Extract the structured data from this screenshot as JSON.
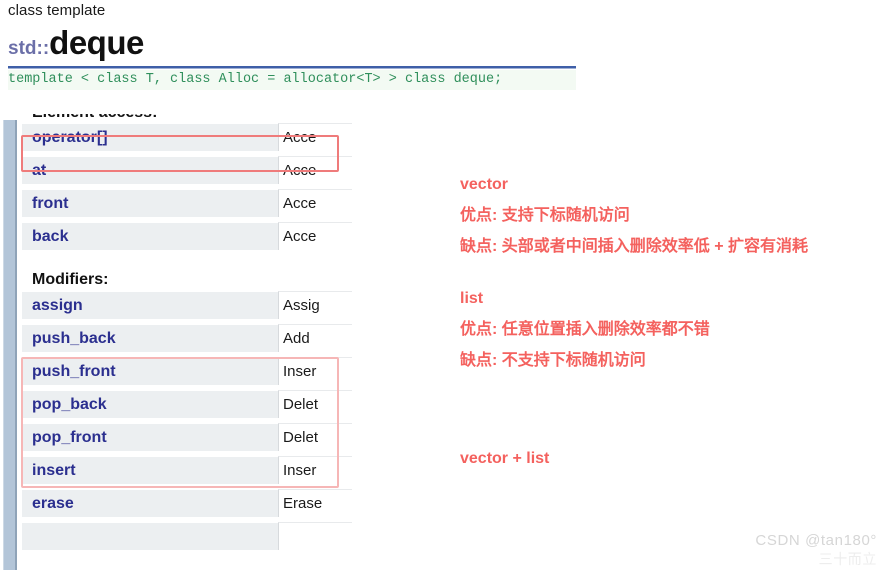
{
  "reference": {
    "kicker": "class template",
    "namespace": "std::",
    "class_name": "deque",
    "prototype": "template < class T, class Alloc = allocator<T> > class deque;"
  },
  "member_table": {
    "sections": [
      {
        "heading": "Element access:",
        "rows": [
          {
            "name": "operator[]",
            "desc": "Acce"
          },
          {
            "name": "at",
            "desc": "Acce"
          },
          {
            "name": "front",
            "desc": "Acce"
          },
          {
            "name": "back",
            "desc": "Acce"
          }
        ]
      },
      {
        "heading": "Modifiers:",
        "rows": [
          {
            "name": "assign",
            "desc": "Assig"
          },
          {
            "name": "push_back",
            "desc": "Add "
          },
          {
            "name": "push_front",
            "desc": "Inser"
          },
          {
            "name": "pop_back",
            "desc": "Delet"
          },
          {
            "name": "pop_front",
            "desc": "Delet"
          },
          {
            "name": "insert",
            "desc": "Inser"
          },
          {
            "name": "erase",
            "desc": "Erase"
          }
        ]
      }
    ]
  },
  "annotations": {
    "highlight_color": "#f08080",
    "note_color": "#f4615e",
    "vector": {
      "title": "vector",
      "pro": "优点: 支持下标随机访问",
      "con": "缺点: 头部或者中间插入删除效率低 + 扩容有消耗"
    },
    "list": {
      "title": "list",
      "pro": "优点: 任意位置插入删除效率都不错",
      "con": "缺点: 不支持下标随机访问"
    },
    "combo": "vector + list"
  },
  "watermark": {
    "line1": "CSDN @tan180°",
    "line2": "三十而立"
  }
}
